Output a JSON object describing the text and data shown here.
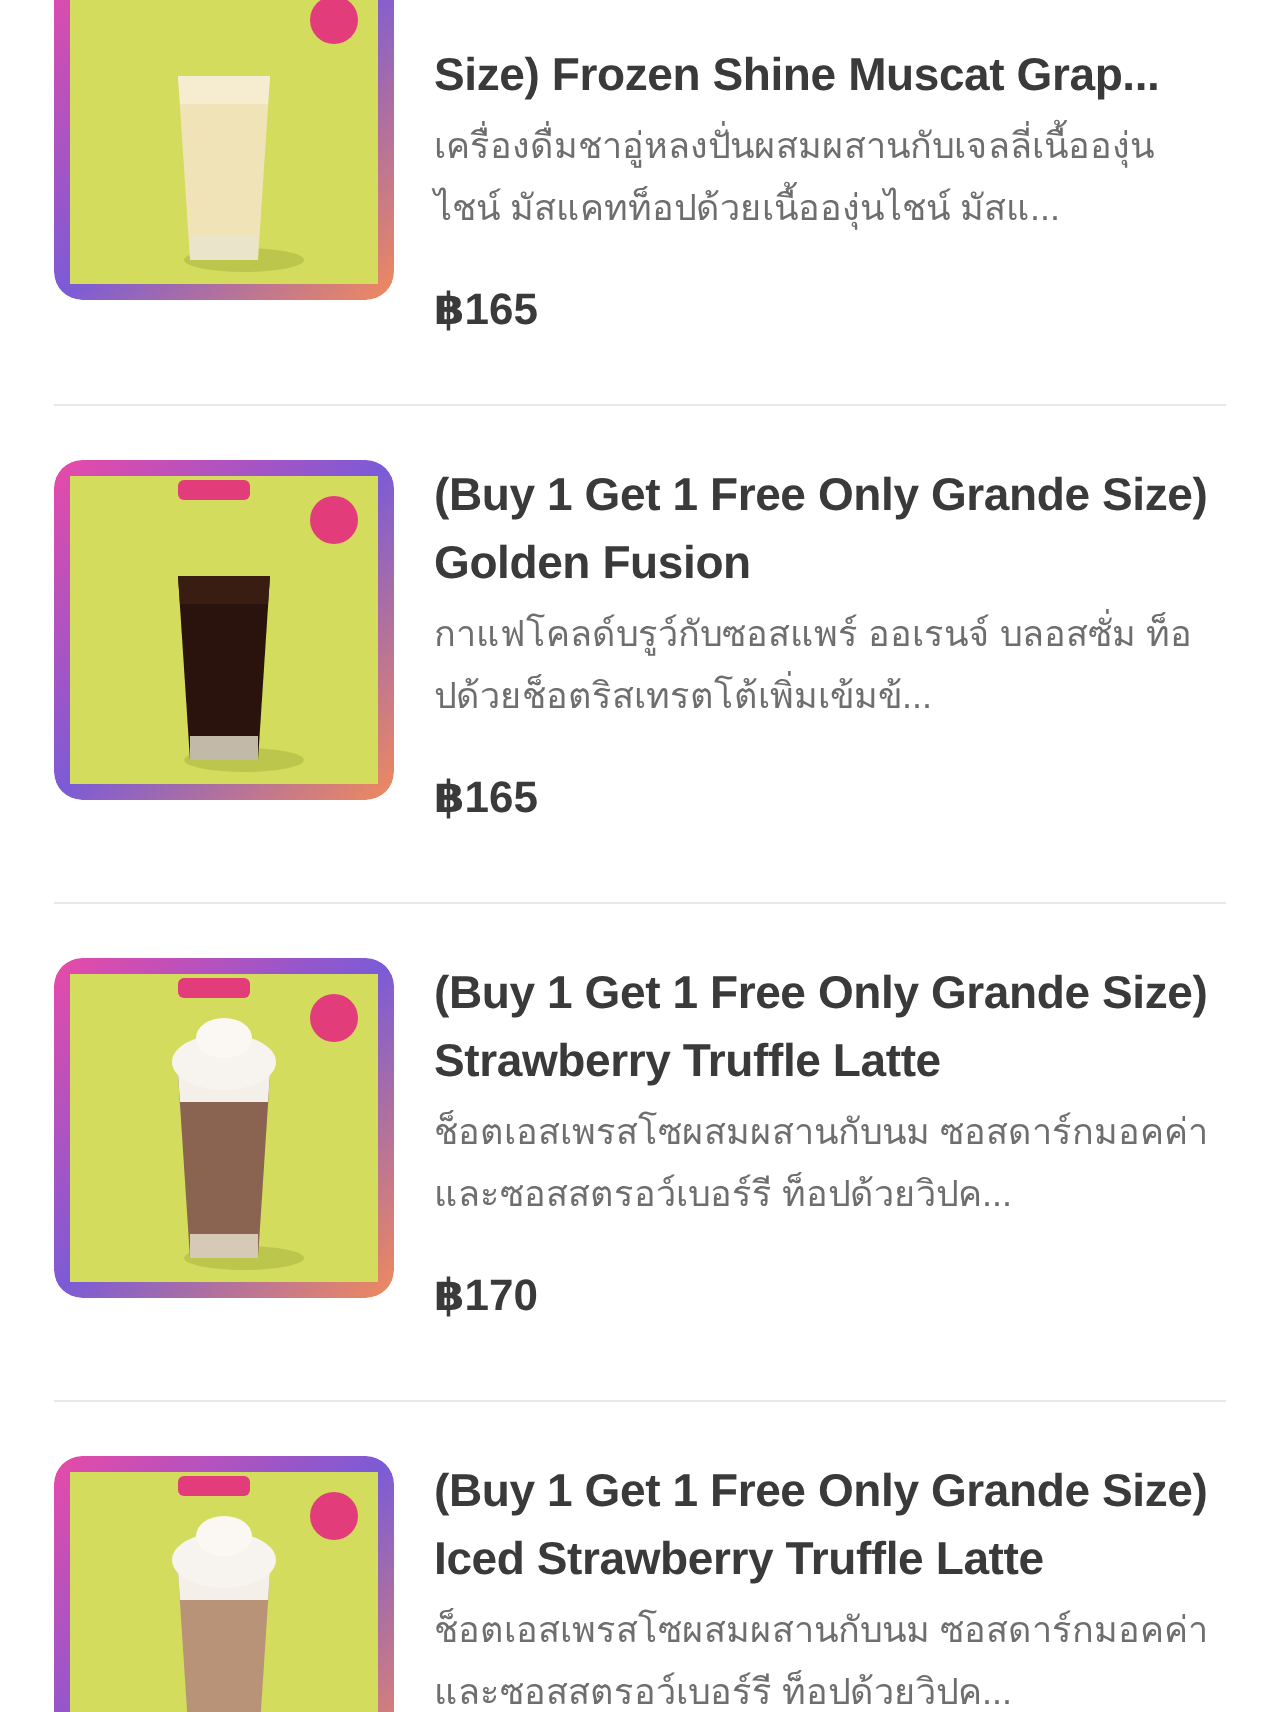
{
  "items": [
    {
      "title": "Size) Frozen Shine Muscat Grap...",
      "description": "เครื่องดื่มชาอู่หลงปั่นผสมผสานกับเจลลี่เนื้อองุ่นไชน์ มัสแคทท็อปด้วยเนื้อองุ่นไชน์ มัสแ...",
      "price": "฿165"
    },
    {
      "title": "(Buy 1 Get 1 Free Only Grande Size) Golden Fusion",
      "description": "กาแฟโคลด์บรูว์กับซอสแพร์ ออเรนจ์ บลอสซั่ม ท็อปด้วยช็อตริสเทรตโต้เพิ่มเข้มข้...",
      "price": "฿165"
    },
    {
      "title": "(Buy 1 Get 1 Free Only Grande Size) Strawberry Truffle Latte",
      "description": "ช็อตเอสเพรสโซผสมผสานกับนม ซอสดาร์กมอคค่าและซอสสตรอว์เบอร์รี ท็อปด้วยวิปค...",
      "price": "฿170"
    },
    {
      "title": "(Buy 1 Get 1 Free Only Grande Size) Iced Strawberry Truffle Latte",
      "description": "ช็อตเอสเพรสโซผสมผสานกับนม ซอสดาร์กมอคค่าและซอสสตรอว์เบอร์รี ท็อปด้วยวิปค..."
    }
  ]
}
